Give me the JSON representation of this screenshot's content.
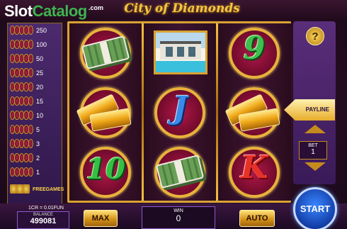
{
  "branding": {
    "logo_slot": "Slot",
    "logo_catalog": "Catalog",
    "logo_com": ".com"
  },
  "game": {
    "title": "City of Diamonds"
  },
  "paytable": {
    "rows": [
      {
        "value": "250",
        "icon": "symbol-stack-icon"
      },
      {
        "value": "100",
        "icon": "symbol-stack-icon"
      },
      {
        "value": "50",
        "icon": "symbol-stack-icon"
      },
      {
        "value": "25",
        "icon": "symbol-stack-icon"
      },
      {
        "value": "20",
        "icon": "symbol-stack-icon"
      },
      {
        "value": "15",
        "icon": "symbol-stack-icon"
      },
      {
        "value": "10",
        "icon": "symbol-stack-icon"
      },
      {
        "value": "5",
        "icon": "symbol-stack-icon"
      },
      {
        "value": "3",
        "icon": "symbol-stack-icon"
      },
      {
        "value": "2",
        "icon": "symbol-stack-icon"
      },
      {
        "value": "1",
        "icon": "symbol-stack-icon"
      },
      {
        "value": "FREEGAMES",
        "icon": "free-games-icon"
      }
    ]
  },
  "reels": [
    [
      "cash-stack-icon",
      "gold-bars-icon",
      "ten-symbol"
    ],
    [
      "villa-icon",
      "j-symbol",
      "cash-stack-icon"
    ],
    [
      "nine-symbol",
      "gold-bars-icon",
      "k-symbol"
    ]
  ],
  "symbols": {
    "nine": "9",
    "j": "J",
    "ten": "10",
    "k": "K"
  },
  "controls": {
    "help_label": "?",
    "payline_label": "PAYLINE",
    "bet_label": "BET",
    "bet_value": "1",
    "denomination": "1CR = 0.01FUN",
    "balance_label": "BALANCE",
    "balance_value": "499081",
    "max_label": "MAX",
    "win_label": "WIN",
    "win_value": "0",
    "auto_label": "AUTO",
    "start_label": "START"
  },
  "colors": {
    "accent_gold": "#d8a233",
    "panel_purple": "#4c2a6e",
    "start_blue": "#123ea8"
  }
}
